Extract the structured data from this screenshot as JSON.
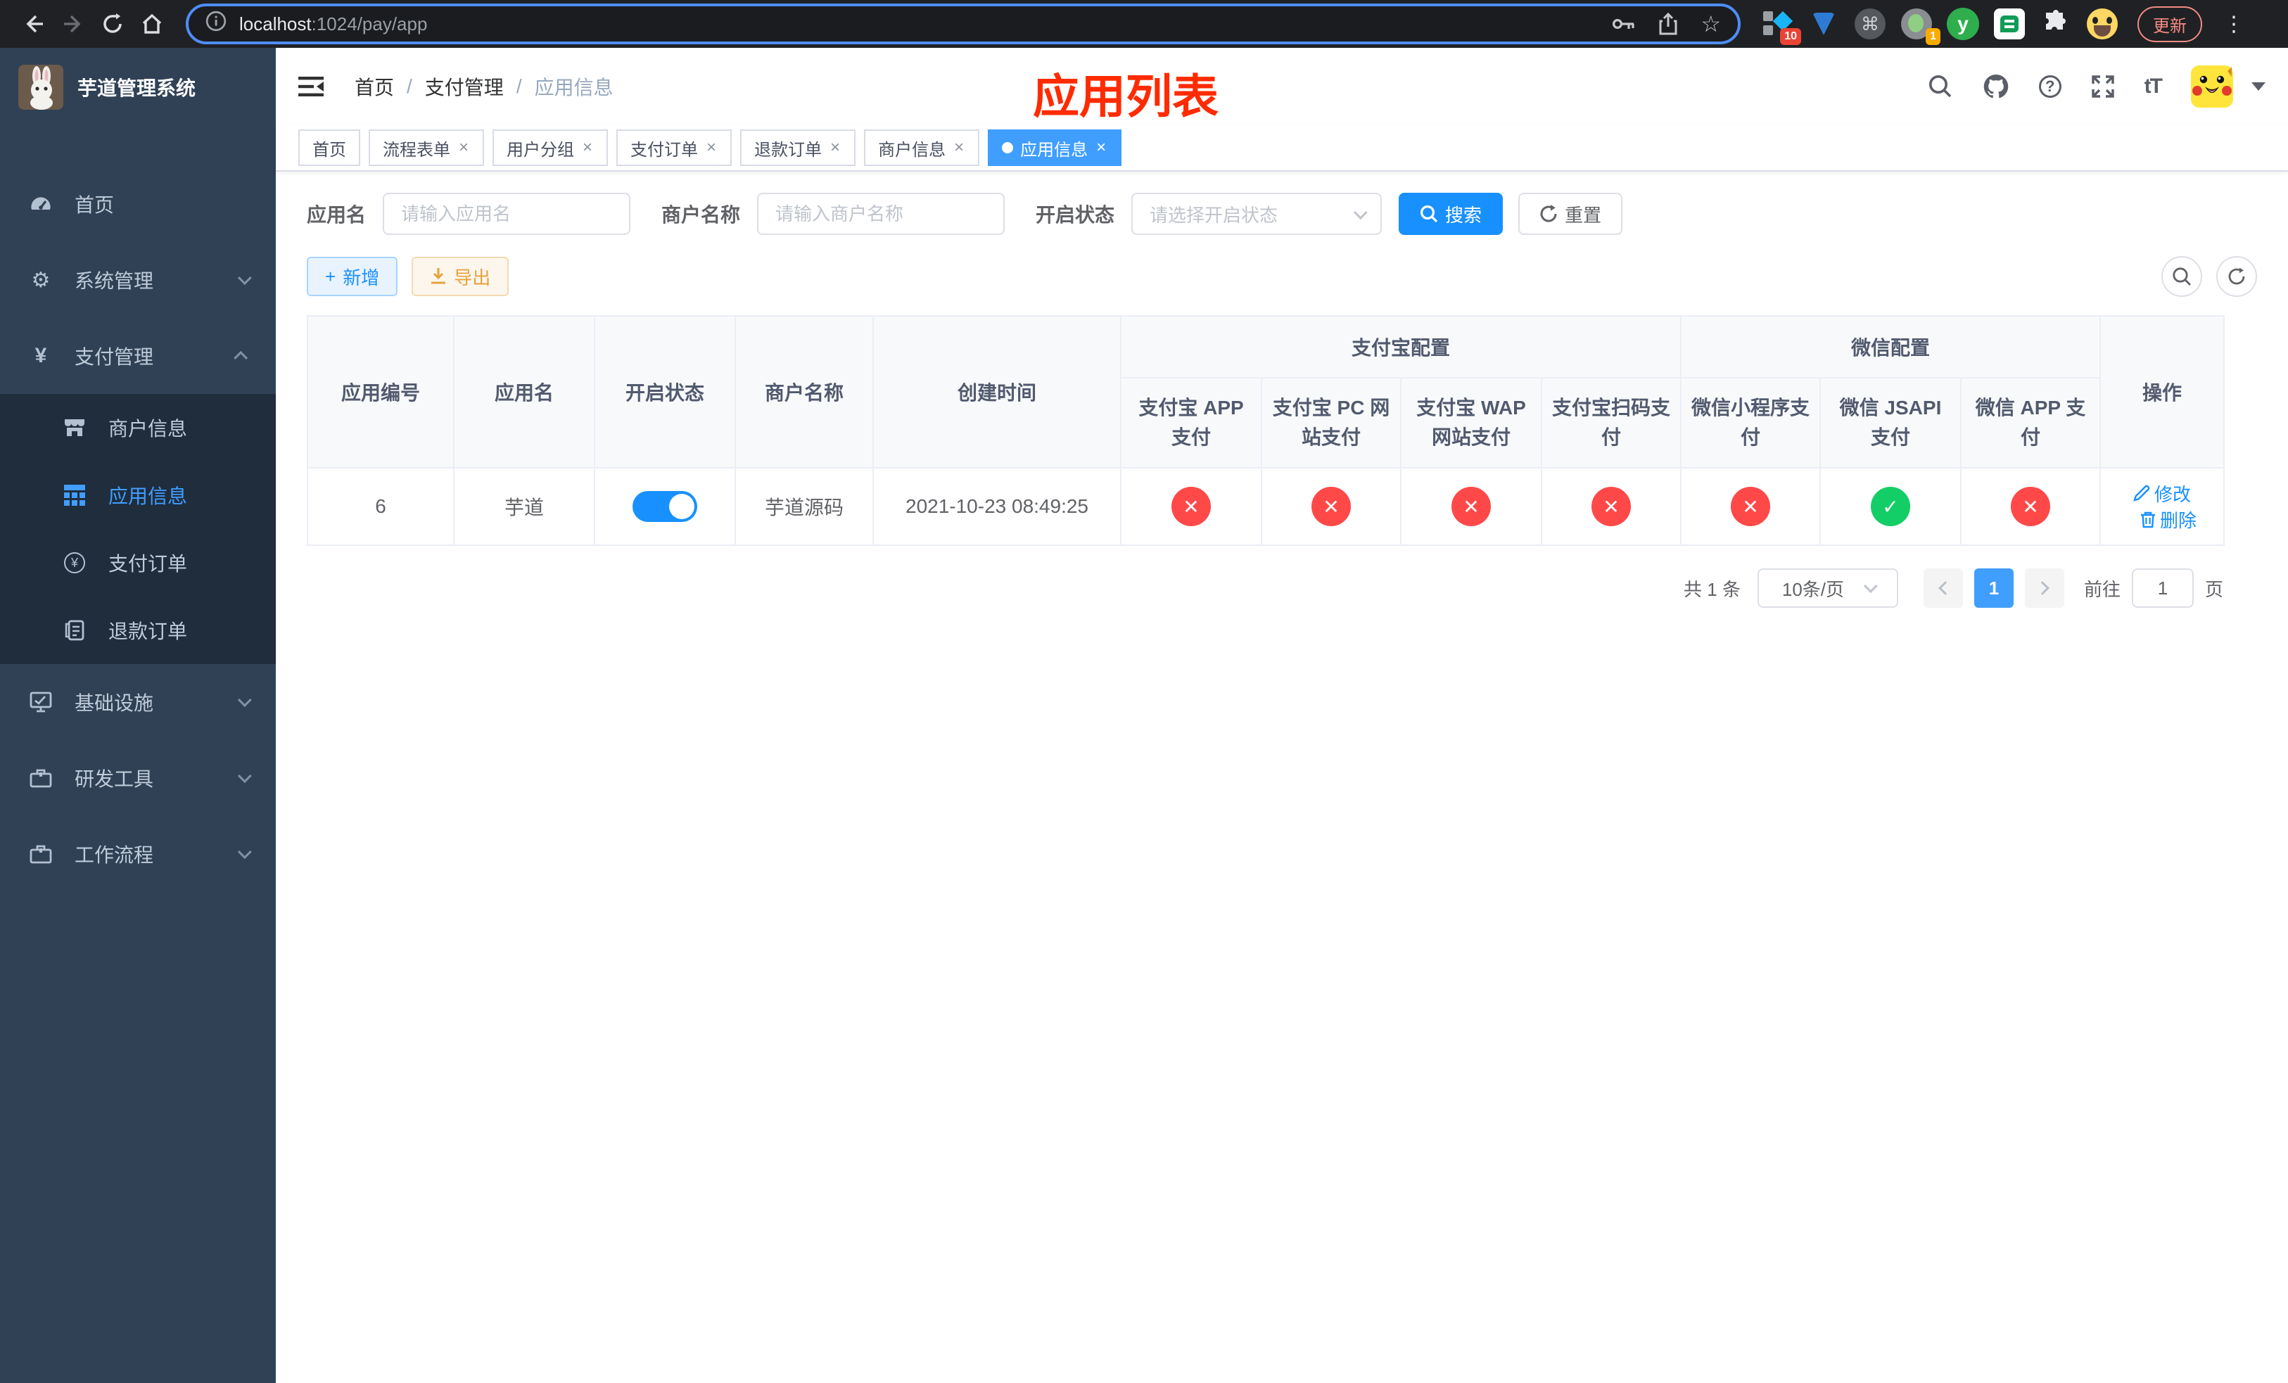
{
  "colors": {
    "accent": "#409eff",
    "primary_button": "#1890ff",
    "danger": "#ff4949",
    "success": "#13ce66",
    "warning": "#e6a23c",
    "overlay_title_red": "#ff2b00",
    "sidebar_bg": "#304156",
    "submenu_bg": "#1f2d3d",
    "browser_bar_bg": "#202124",
    "url_focus_ring": "#4e8df6"
  },
  "browser": {
    "url_host": "localhost",
    "url_rest": ":1024/pay/app",
    "update_label": "更新",
    "ext1_badge": "10",
    "ext4_badge": "1",
    "ext_y_letter": "y"
  },
  "icons": {
    "tab_close": "×",
    "check": "✓",
    "cross": "✕",
    "star": "☆",
    "yen": "¥",
    "gear": "⚙",
    "command": "⌘",
    "more_vertical": "⋮",
    "plus": "+",
    "question": "?",
    "font_size": "tT"
  },
  "sidebar": {
    "title": "芋道管理系统",
    "items": [
      {
        "label": "首页"
      },
      {
        "label": "系统管理"
      },
      {
        "label": "支付管理"
      },
      {
        "label": "商户信息"
      },
      {
        "label": "应用信息"
      },
      {
        "label": "支付订单"
      },
      {
        "label": "退款订单"
      },
      {
        "label": "基础设施"
      },
      {
        "label": "研发工具"
      },
      {
        "label": "工作流程"
      }
    ]
  },
  "header": {
    "breadcrumb": [
      "首页",
      "支付管理",
      "应用信息"
    ],
    "separator": "/",
    "overlay_title": "应用列表"
  },
  "tabs": {
    "items": [
      {
        "label": "首页",
        "closable": false,
        "active": false
      },
      {
        "label": "流程表单",
        "closable": true,
        "active": false
      },
      {
        "label": "用户分组",
        "closable": true,
        "active": false
      },
      {
        "label": "支付订单",
        "closable": true,
        "active": false
      },
      {
        "label": "退款订单",
        "closable": true,
        "active": false
      },
      {
        "label": "商户信息",
        "closable": true,
        "active": false
      },
      {
        "label": "应用信息",
        "closable": true,
        "active": true
      }
    ]
  },
  "filters": {
    "app_name_label": "应用名",
    "app_name_placeholder": "请输入应用名",
    "merchant_label": "商户名称",
    "merchant_placeholder": "请输入商户名称",
    "status_label": "开启状态",
    "status_placeholder": "请选择开启状态",
    "search_label": "搜索",
    "reset_label": "重置"
  },
  "toolbar": {
    "add_label": "新增",
    "export_label": "导出"
  },
  "table": {
    "group_cols": {
      "alipay": "支付宝配置",
      "wechat": "微信配置"
    },
    "cols": {
      "app_id": "应用编号",
      "app_name": "应用名",
      "enabled": "开启状态",
      "merchant": "商户名称",
      "created": "创建时间",
      "alipay_app": "支付宝 APP 支付",
      "alipay_pc": "支付宝 PC 网站支付",
      "alipay_wap": "支付宝 WAP 网站支付",
      "alipay_qr": "支付宝扫码支付",
      "wx_lite": "微信小程序支付",
      "wx_jsapi": "微信 JSAPI 支付",
      "wx_app": "微信 APP 支付",
      "ops": "操作"
    },
    "rows": [
      {
        "app_id": "6",
        "app_name": "芋道",
        "enabled": true,
        "merchant": "芋道源码",
        "created": "2021-10-23 08:49:25",
        "alipay_app": false,
        "alipay_pc": false,
        "alipay_wap": false,
        "alipay_qr": false,
        "wx_lite": false,
        "wx_jsapi": true,
        "wx_app": false
      }
    ],
    "edit_label": "修改",
    "delete_label": "删除"
  },
  "pagination": {
    "total": "共 1 条",
    "page_size": "10条/页",
    "page": "1",
    "goto_label": "前往",
    "goto_value": "1",
    "unit_label": "页"
  }
}
